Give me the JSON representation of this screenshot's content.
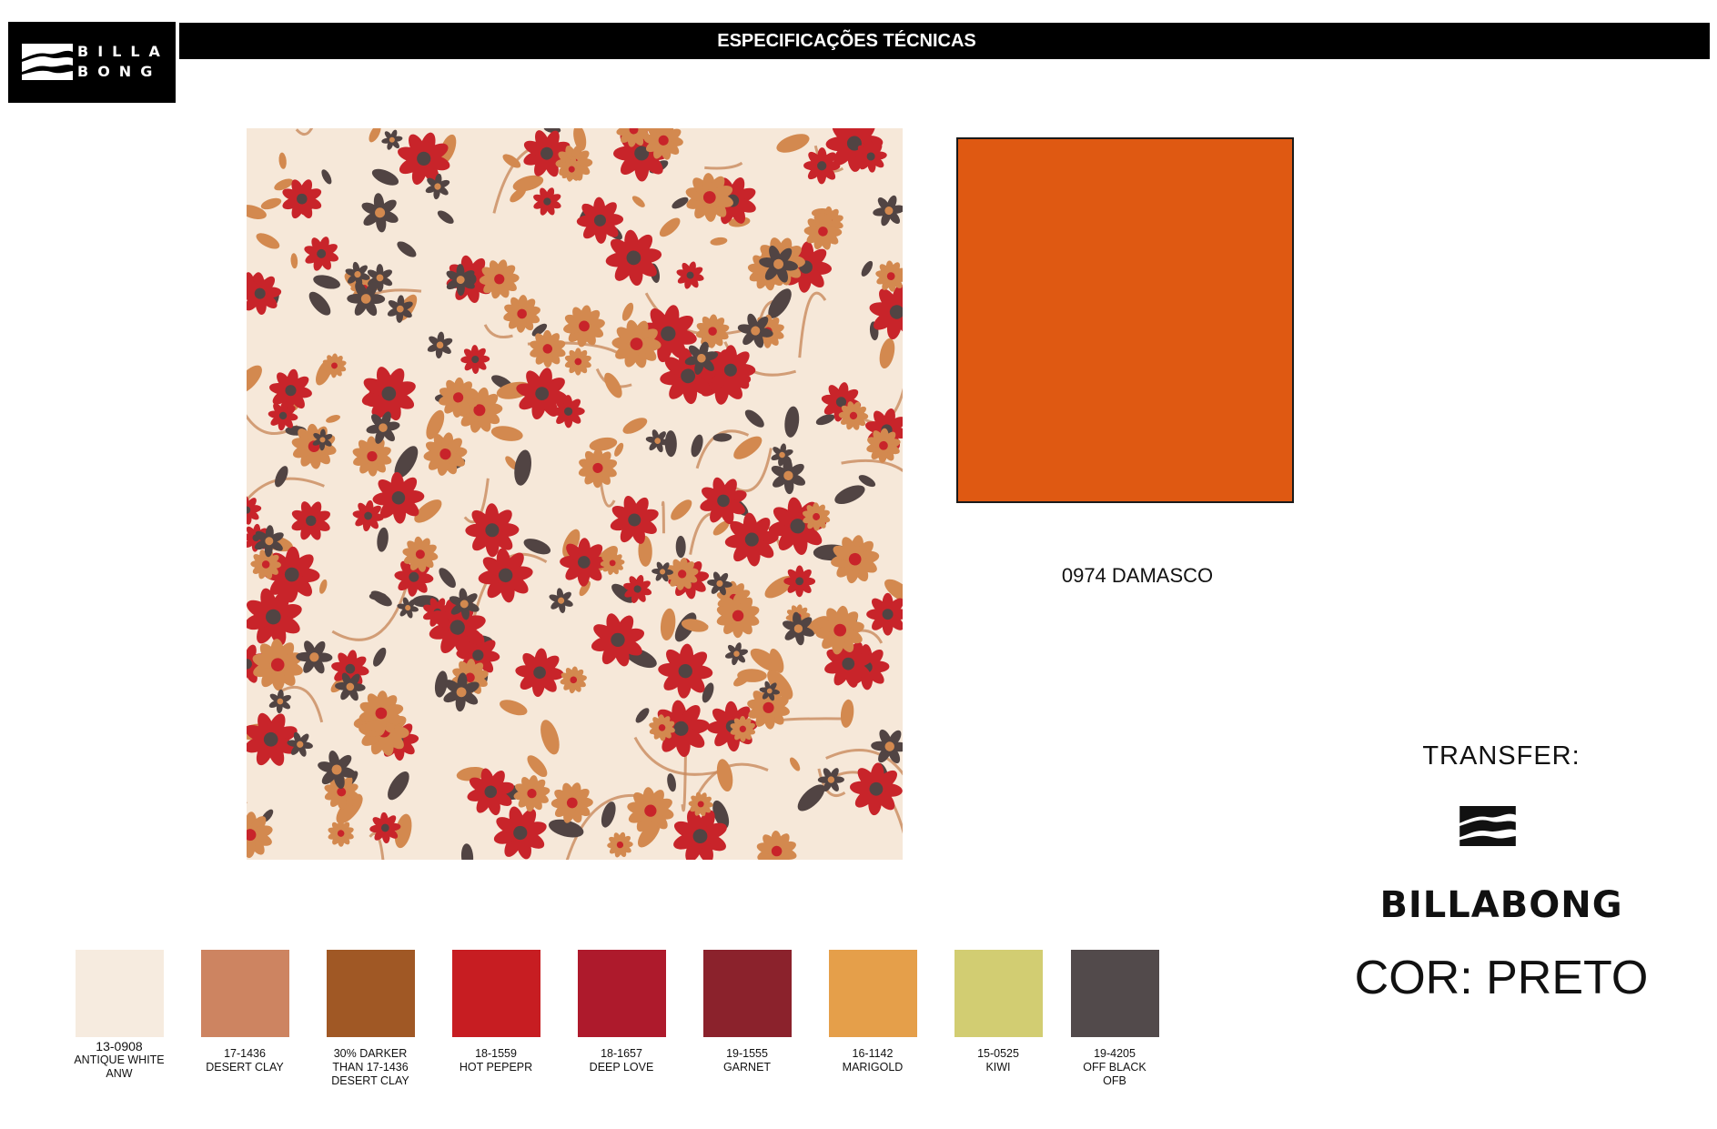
{
  "brand": {
    "logo_text_line1": "BILLA",
    "logo_text_line2": "BONG"
  },
  "header": {
    "title": "ESPECIFICAÇÕES TÉCNICAS"
  },
  "print": {
    "colors": {
      "background": "#f6e8d9",
      "red": "#c8242a",
      "clay": "#d3894f",
      "dark": "#514443",
      "vine": "#c98a5d"
    }
  },
  "solid": {
    "color": "#df5912",
    "label": "0974 DAMASCO"
  },
  "transfer": {
    "label": "TRANSFER:",
    "brand_name": "BILLABONG",
    "cor_label": "COR: PRETO"
  },
  "palette": [
    {
      "code": "13-0908",
      "name": "ANTIQUE WHITE",
      "extra": "ANW",
      "color": "#f6ebdf"
    },
    {
      "code": "17-1436",
      "name": "DESERT CLAY",
      "extra": "",
      "color": "#cd8461"
    },
    {
      "code": "30% DARKER",
      "name": "THAN 17-1436",
      "extra": "DESERT CLAY",
      "color": "#a05825"
    },
    {
      "code": "18-1559",
      "name": "HOT PEPEPR",
      "extra": "",
      "color": "#c71d22"
    },
    {
      "code": "18-1657",
      "name": "DEEP LOVE",
      "extra": "",
      "color": "#ae1a2c"
    },
    {
      "code": "19-1555",
      "name": "GARNET",
      "extra": "",
      "color": "#8b222c"
    },
    {
      "code": "16-1142",
      "name": "MARIGOLD",
      "extra": "",
      "color": "#e59f4a"
    },
    {
      "code": "15-0525",
      "name": "KIWI",
      "extra": "",
      "color": "#d2cd72"
    },
    {
      "code": "19-4205",
      "name": "OFF BLACK",
      "extra": "OFB",
      "color": "#524a4b"
    }
  ]
}
